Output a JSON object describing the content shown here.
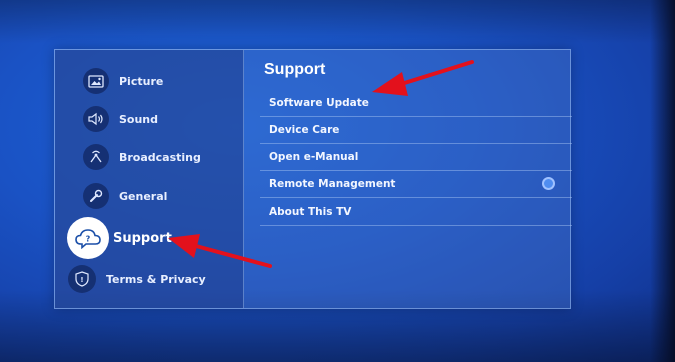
{
  "sidebar": {
    "items": [
      {
        "label": "Picture",
        "icon": "picture-icon"
      },
      {
        "label": "Sound",
        "icon": "sound-icon"
      },
      {
        "label": "Broadcasting",
        "icon": "broadcasting-icon"
      },
      {
        "label": "General",
        "icon": "wrench-icon"
      },
      {
        "label": "Support",
        "icon": "support-cloud-icon",
        "selected": true
      },
      {
        "label": "Terms & Privacy",
        "icon": "shield-icon"
      }
    ]
  },
  "main": {
    "title": "Support",
    "menu": [
      {
        "label": "Software Update"
      },
      {
        "label": "Device Care"
      },
      {
        "label": "Open e-Manual"
      },
      {
        "label": "Remote Management",
        "toggle": "radio"
      },
      {
        "label": "About This TV"
      }
    ]
  },
  "colors": {
    "background": "#1a52c4",
    "annotation_arrow": "#e3111c",
    "selected_icon_bg": "#ffffff"
  }
}
